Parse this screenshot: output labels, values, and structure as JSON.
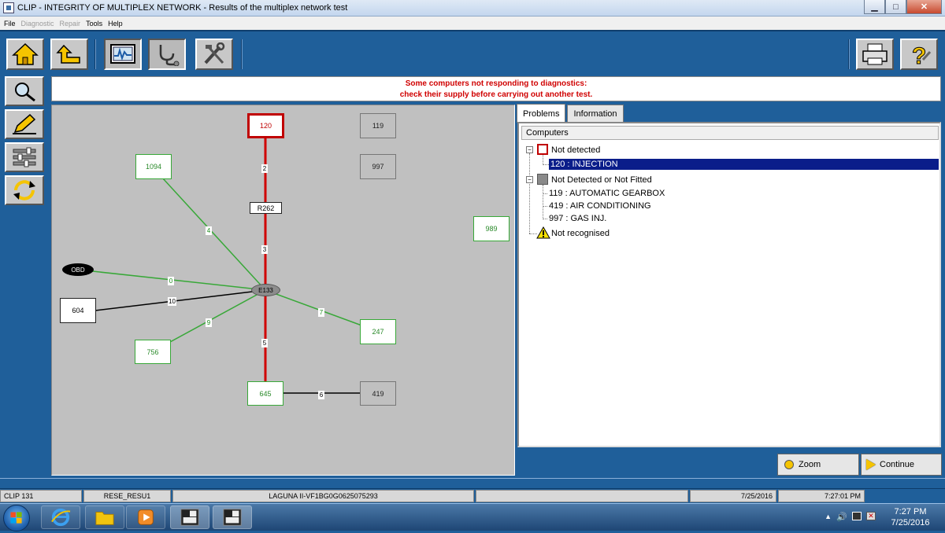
{
  "window": {
    "title": "CLIP - INTEGRITY OF MULTIPLEX NETWORK - Results of the multiplex network test"
  },
  "menu": {
    "items": [
      {
        "label": "File",
        "enabled": true
      },
      {
        "label": "Diagnostic",
        "enabled": false
      },
      {
        "label": "Repair",
        "enabled": false
      },
      {
        "label": "Tools",
        "enabled": true
      },
      {
        "label": "Help",
        "enabled": true
      }
    ]
  },
  "banner": {
    "line1": "Some computers not responding to diagnostics:",
    "line2": "check their supply before carrying out another test."
  },
  "network": {
    "nodes": {
      "n120": "120",
      "n119": "119",
      "n997": "997",
      "n1094": "1094",
      "r262": "R262",
      "n989": "989",
      "obd": "OBD",
      "e133": "E133",
      "n604": "604",
      "n247": "247",
      "n756": "756",
      "n645": "645",
      "n419": "419"
    },
    "links": {
      "l2": "2",
      "l3": "3",
      "l4": "4",
      "l0": "0",
      "l10": "10",
      "l9": "9",
      "l7": "7",
      "l5": "5",
      "l6": "6"
    }
  },
  "tabs": {
    "problems": "Problems",
    "information": "Information"
  },
  "tree": {
    "header": "Computers",
    "not_detected": "Not detected",
    "injection": "120 : INJECTION",
    "not_fitted": "Not Detected or Not Fitted",
    "gearbox": "119 : AUTOMATIC GEARBOX",
    "aircon": "419 : AIR CONDITIONING",
    "gasinj": "997 : GAS INJ.",
    "not_recognised": "Not recognised"
  },
  "actions": {
    "zoom": "Zoom",
    "continue": "Continue"
  },
  "statusbar": {
    "clip": "CLIP 131",
    "screen": "RESE_RESU1",
    "vehicle": "LAGUNA II-VF1BG0G0625075293",
    "date": "7/25/2016",
    "time": "7:27:01 PM"
  },
  "taskbar": {
    "time": "7:27 PM",
    "date": "7/25/2016"
  },
  "colors": {
    "accent": "#1f5f9a",
    "error": "#c00000",
    "ok": "#38a838",
    "selection": "#0a1d8a"
  }
}
